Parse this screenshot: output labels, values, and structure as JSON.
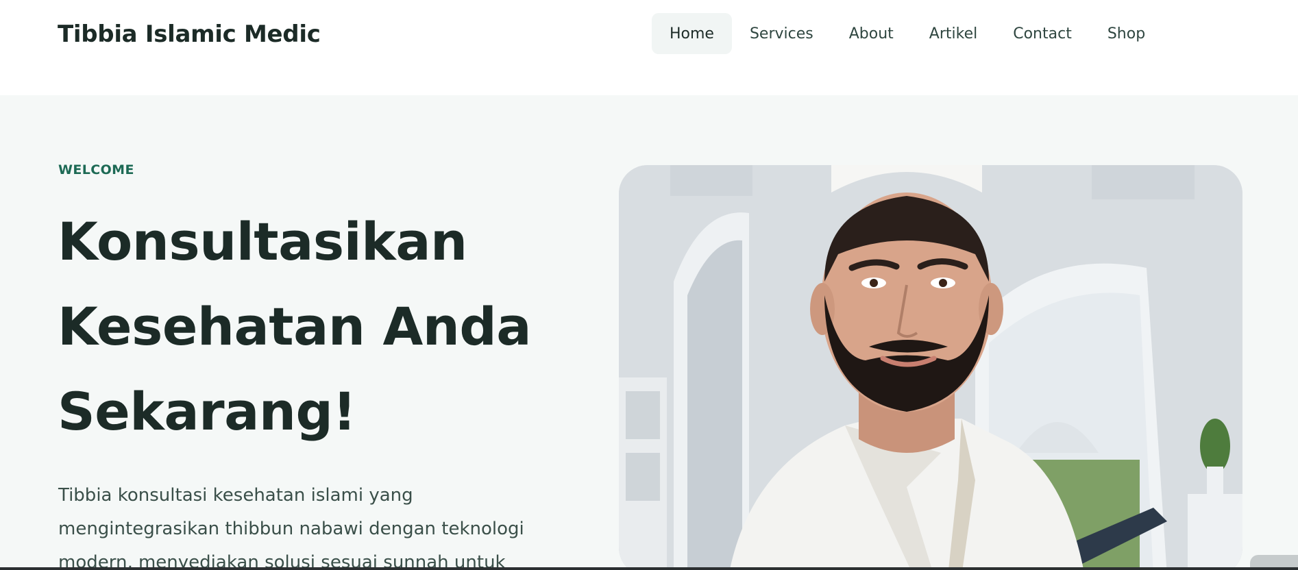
{
  "header": {
    "brand": "Tibbia Islamic Medic",
    "nav": [
      {
        "label": "Home",
        "active": true
      },
      {
        "label": "Services",
        "active": false
      },
      {
        "label": "About",
        "active": false
      },
      {
        "label": "Artikel",
        "active": false
      },
      {
        "label": "Contact",
        "active": false
      },
      {
        "label": "Shop",
        "active": false
      }
    ]
  },
  "hero": {
    "eyebrow": "WELCOME",
    "headline_lines": [
      "Konsultasikan",
      "Kesehatan Anda",
      "Sekarang!"
    ],
    "lead": "Tibbia konsultasi kesehatan islami yang mengintegrasikan thibbun nabawi dengan teknologi modern, menyediakan solusi sesuai sunnah untuk",
    "image_icon": "doctor-portrait-photo"
  },
  "colors": {
    "accent": "#1d6a55",
    "heading": "#1c2b27",
    "nav_active_bg": "#f1f5f4",
    "hero_bg": "#f5f8f7"
  }
}
